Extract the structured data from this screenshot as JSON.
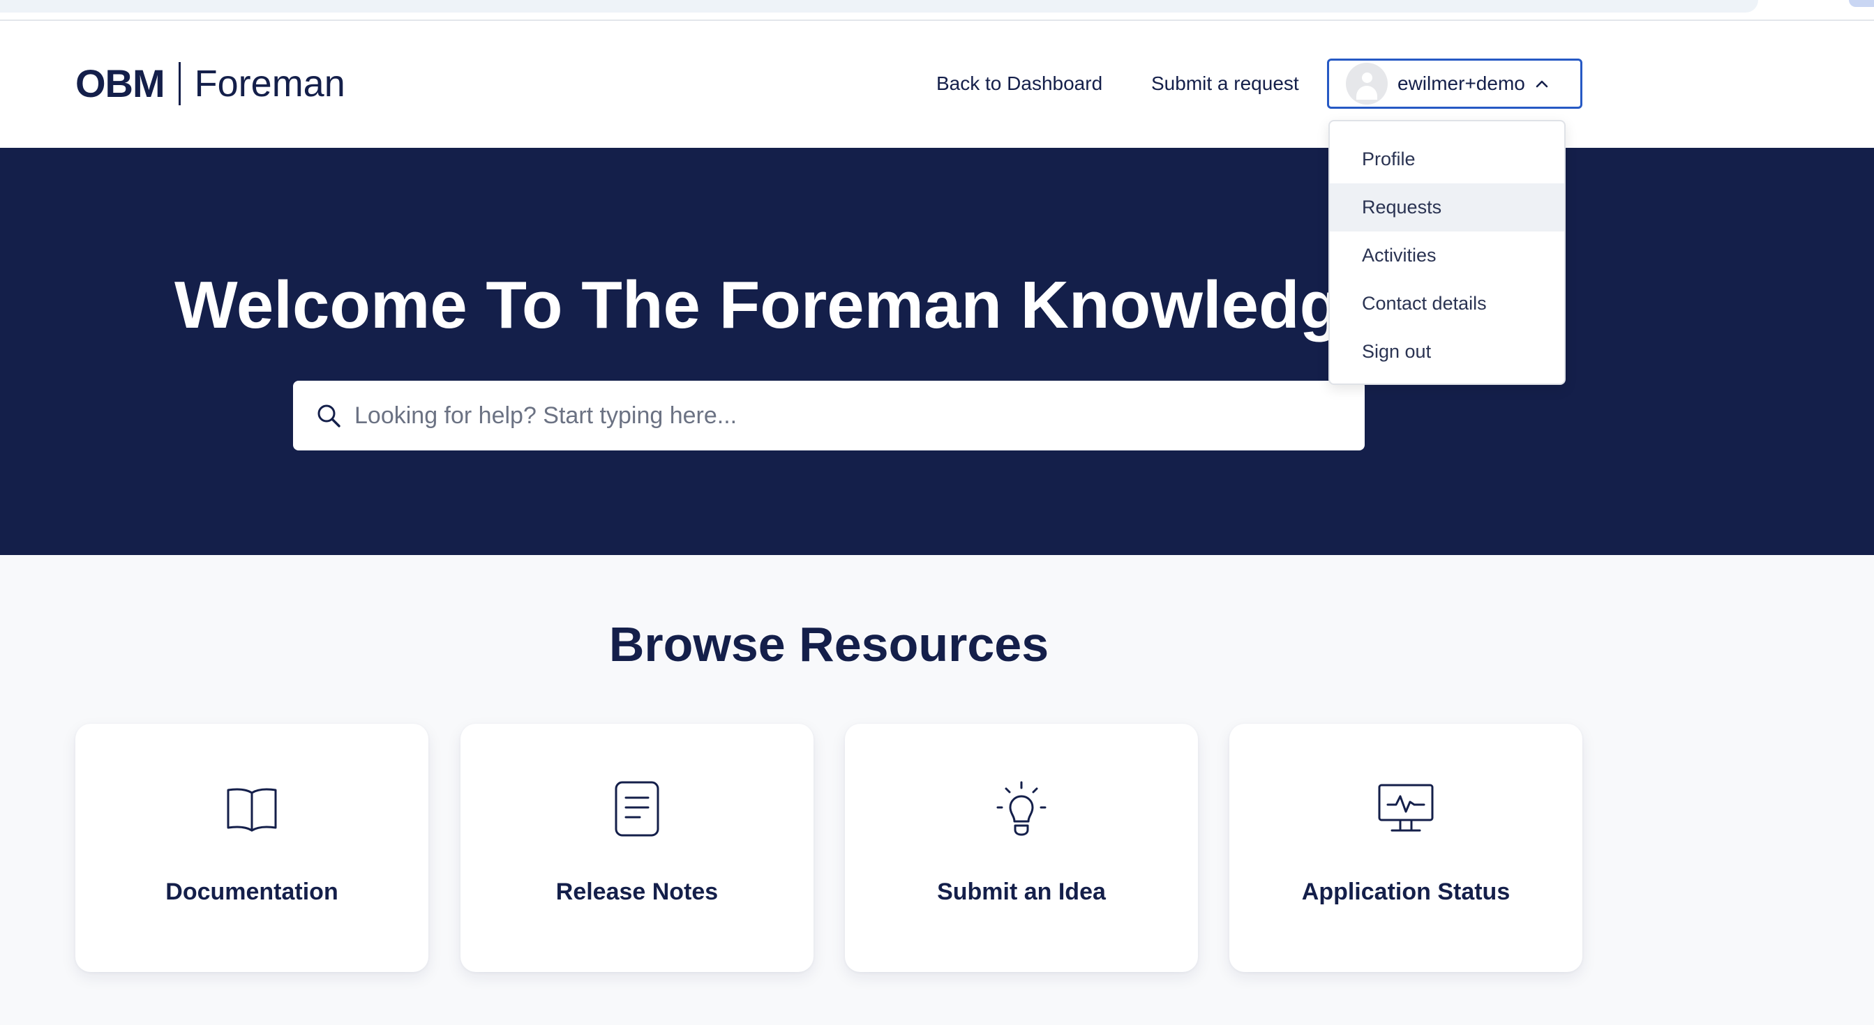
{
  "brand": {
    "logo_mark": "OBM",
    "logo_product": "Foreman"
  },
  "nav": {
    "back_label": "Back to Dashboard",
    "submit_label": "Submit a request"
  },
  "user_menu": {
    "username": "ewilmer+demo",
    "expanded": true,
    "items": [
      {
        "label": "Profile"
      },
      {
        "label": "Requests",
        "highlighted": true
      },
      {
        "label": "Activities"
      },
      {
        "label": "Contact details"
      },
      {
        "label": "Sign out"
      }
    ]
  },
  "hero": {
    "title": "Welcome To The Foreman Knowledge",
    "search_placeholder": "Looking for help? Start typing here...",
    "search_value": ""
  },
  "browse": {
    "title": "Browse Resources",
    "cards": [
      {
        "label": "Documentation",
        "icon": "book-icon"
      },
      {
        "label": "Release Notes",
        "icon": "document-icon"
      },
      {
        "label": "Submit an Idea",
        "icon": "lightbulb-icon"
      },
      {
        "label": "Application Status",
        "icon": "monitor-pulse-icon"
      }
    ]
  },
  "colors": {
    "navy": "#141f4a",
    "accent_border": "#2659c4",
    "page_bg": "#f8f9fb"
  }
}
